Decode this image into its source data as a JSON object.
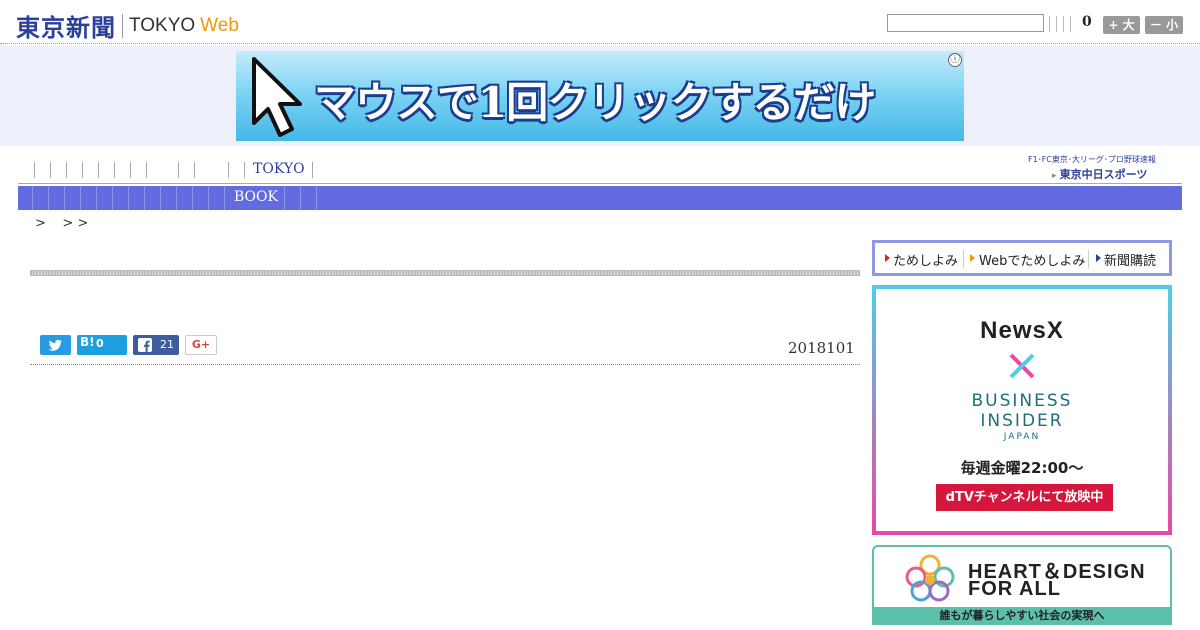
{
  "header": {
    "logo_jp": "東京新聞",
    "logo_tokyo": "TOKYO",
    "logo_web": "Web",
    "search_value": "",
    "count": "0",
    "font_larger_label": "+ 大",
    "font_smaller_label": "－ 小"
  },
  "ad_banner": {
    "text": "マウスで1回クリックするだけ",
    "info_icon": "ⓘ"
  },
  "nav": {
    "primary_tokyo": "TOKYO",
    "secondary_book": "BOOK",
    "sub_link_line1": "F1･FC東京･大リーグ･プロ野球速報",
    "sub_link_line2": "東京中日スポーツ"
  },
  "breadcrumb": ">    > >",
  "article": {
    "date": "2018101",
    "share": {
      "twitter_icon": "twitter-bird",
      "hatena_label": "B!",
      "hatena_count": "0",
      "facebook_count": "21",
      "googleplus_label": "G+"
    }
  },
  "sidebar": {
    "trial_links": [
      "ためしよみ",
      "Webでためしよみ",
      "新聞購読"
    ],
    "newsx_ad": {
      "logo": "NewsX",
      "partner_line1": "BUSINESS",
      "partner_line2": "INSIDER",
      "partner_sub": "JAPAN",
      "schedule": "毎週金曜22:00〜",
      "button": "dTVチャンネルにて放映中"
    },
    "heart_design_ad": {
      "title_line1": "HEART＆DESIGN",
      "title_line2": "FOR ALL",
      "footer": "誰もが暮らしやすい社会の実現へ"
    }
  },
  "colors": {
    "brand_blue": "#2b3f9c",
    "nav_purple": "#636be0",
    "web_orange": "#f39800"
  }
}
